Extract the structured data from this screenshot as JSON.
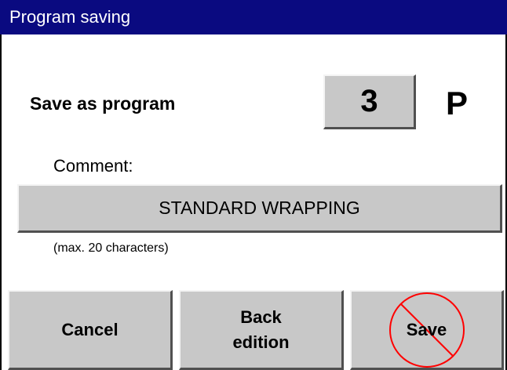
{
  "window": {
    "title": "Program saving"
  },
  "program": {
    "label": "Save as program",
    "number": "3",
    "unit": "P"
  },
  "comment": {
    "label": "Comment:",
    "value": "STANDARD WRAPPING",
    "hint": "(max. 20 characters)"
  },
  "buttons": {
    "cancel": "Cancel",
    "back_line1": "Back",
    "back_line2": "edition",
    "save": "Save",
    "save_state": "disabled"
  },
  "colors": {
    "titlebar": "#0a0a80",
    "button_face": "#c8c8c8",
    "forbidden_mark": "#ff0000"
  },
  "icons": {
    "save_overlay": "forbidden-icon"
  }
}
